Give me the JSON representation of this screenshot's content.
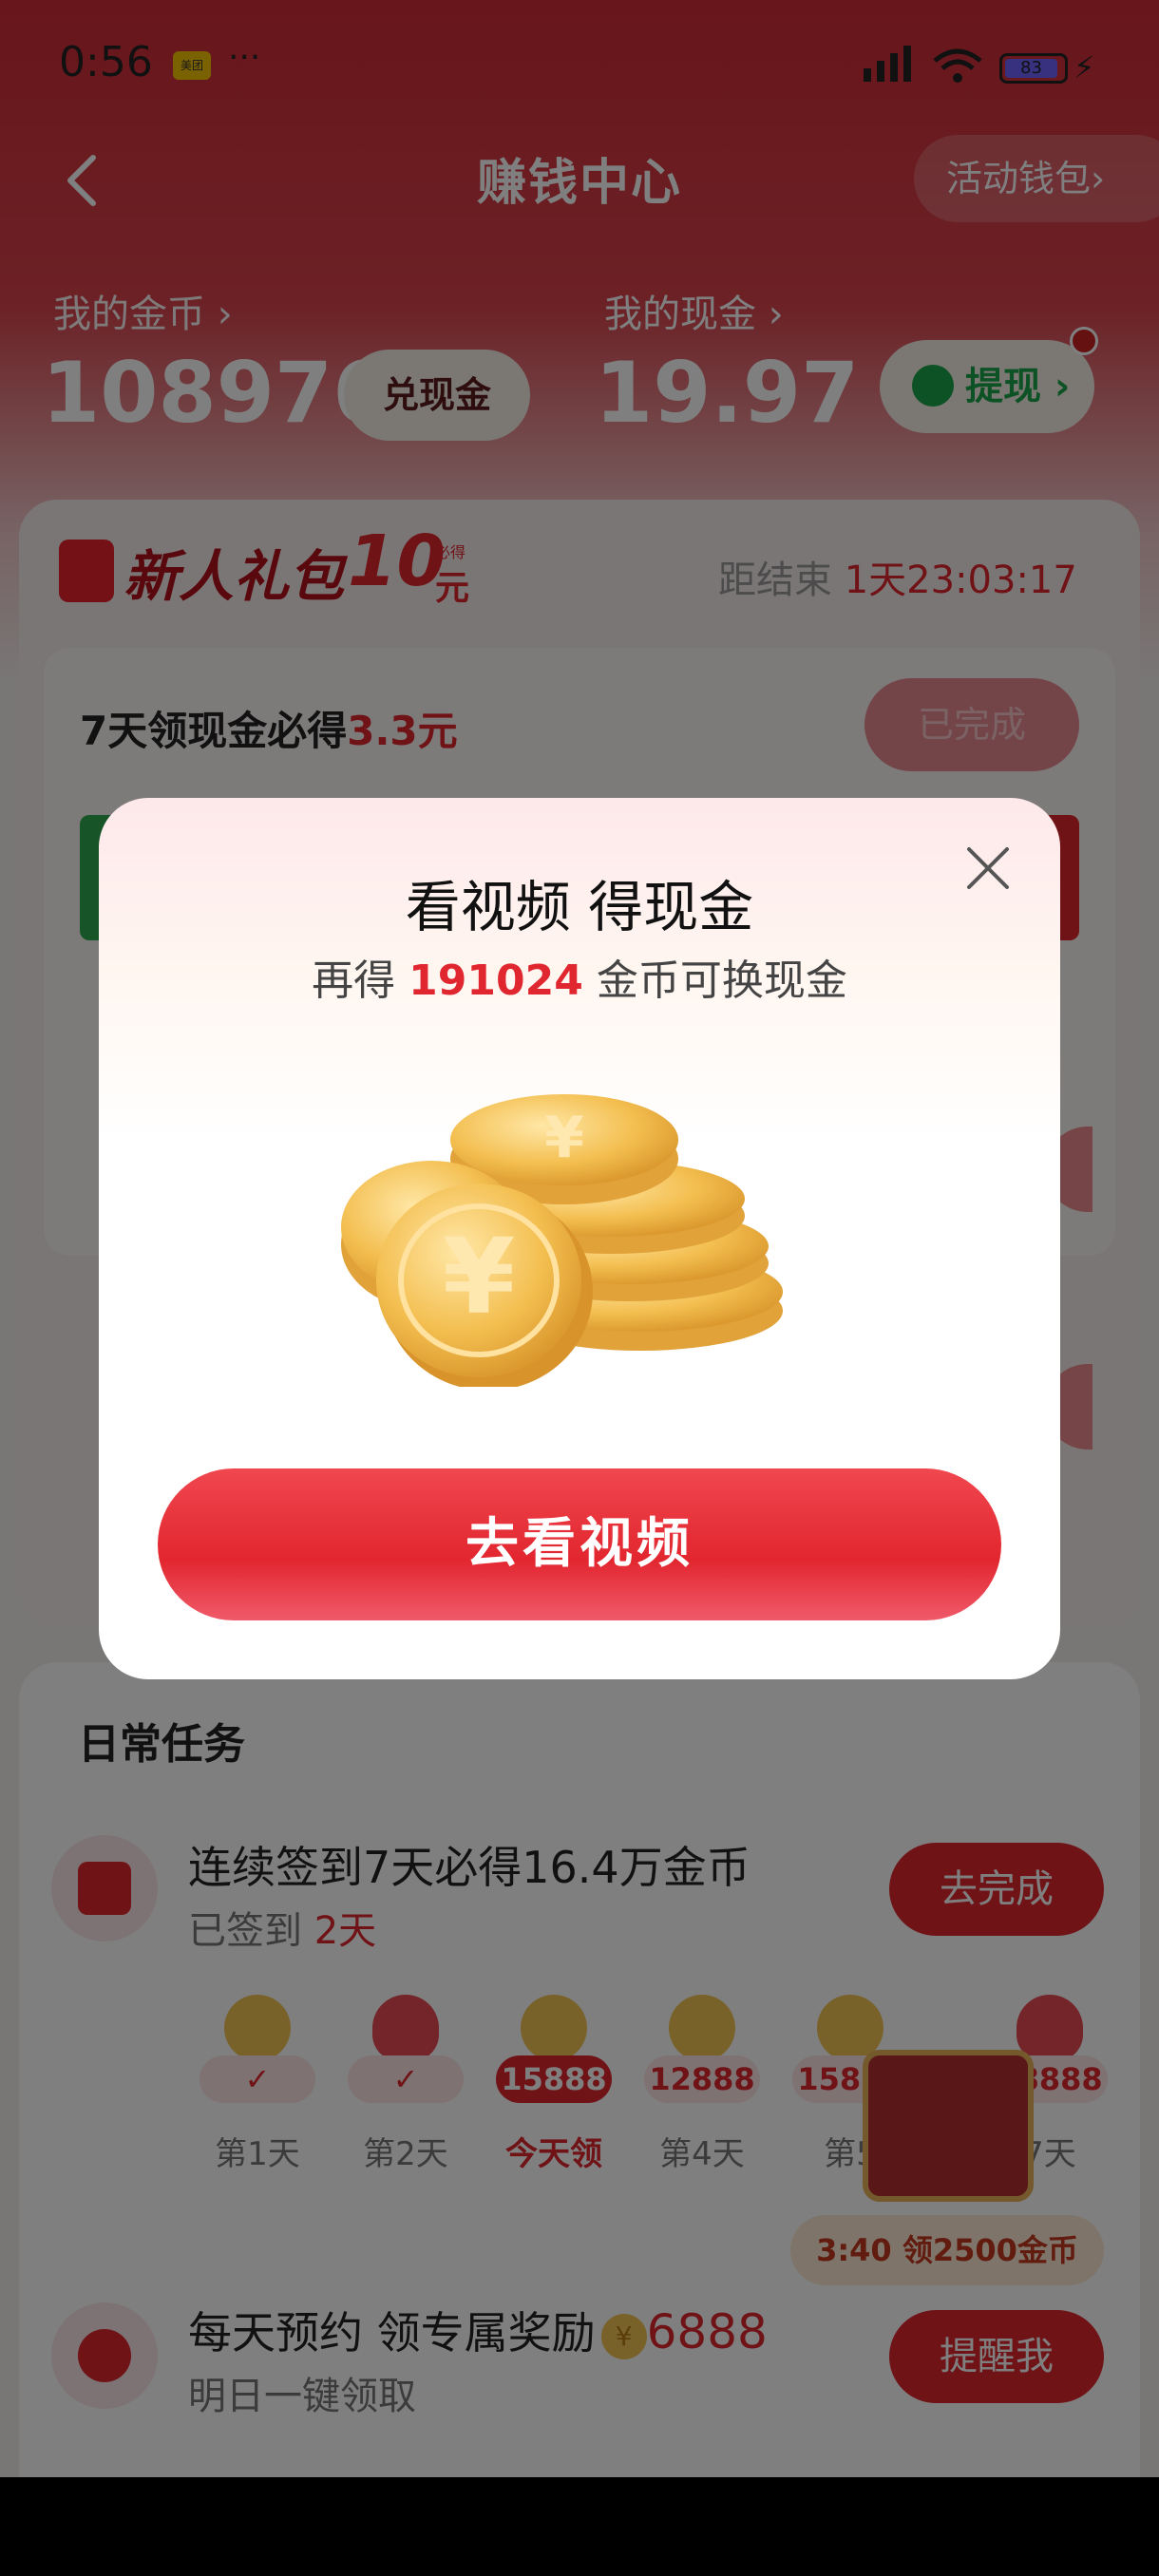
{
  "status_bar": {
    "time": "0:56",
    "notif_badge": "美团",
    "more_dots": "···",
    "battery_level": "83"
  },
  "nav": {
    "title": "赚钱中心",
    "wallet_button": "活动钱包",
    "wallet_chevron": "›"
  },
  "balances": {
    "coins_label": "我的金币 ›",
    "coins_value": "108976",
    "exchange_button": "兑现金",
    "cash_label": "我的现金 ›",
    "cash_value": "19.97",
    "withdraw_button": "提现 ›"
  },
  "newbie_gift": {
    "title": "新人礼包",
    "amount": "10",
    "must_tag": "必得",
    "unit": "元",
    "countdown_prefix": "距结束",
    "countdown_value": "1天23:03:17",
    "seven_day_prefix": "7天领现金必得",
    "seven_day_amount": "3.3元",
    "done_button": "已完成"
  },
  "daily": {
    "title": "日常任务",
    "signin_task_title": "连续签到7天必得16.4万金币",
    "signin_sub_prefix": "已签到",
    "signin_sub_days": "2天",
    "signin_button": "去完成",
    "days": [
      {
        "amount": "✓",
        "label": "第1天"
      },
      {
        "amount": "✓",
        "label": "第2天"
      },
      {
        "amount": "15888",
        "label": "今天领"
      },
      {
        "amount": "12888",
        "label": "第4天"
      },
      {
        "amount": "15888",
        "label": "第5"
      },
      {
        "amount": "58888",
        "label": "7天"
      }
    ],
    "chest_timer": "3:40 领2500金币",
    "reserve_task_title": "每天预约 领专属奖励",
    "reserve_yen": "¥",
    "reserve_amount": "6888",
    "reserve_sub": "明日一键领取",
    "reserve_button": "提醒我"
  },
  "modal": {
    "title": "看视频 得现金",
    "sub_prefix": "再得",
    "sub_amount": "191024",
    "sub_suffix": "金币可换现金",
    "coin_glyph": "¥",
    "cta_button": "去看视频"
  },
  "colors": {
    "brand_red": "#e0262f",
    "coin_gold": "#f2c453",
    "wechat_green": "#1aa54a"
  },
  "icons": [
    "back-arrow-icon",
    "chevron-right-icon",
    "wechat-icon",
    "gift-icon",
    "calendar-icon",
    "alarm-clock-icon",
    "close-icon",
    "coin-stack-icon",
    "treasure-chest-icon"
  ]
}
